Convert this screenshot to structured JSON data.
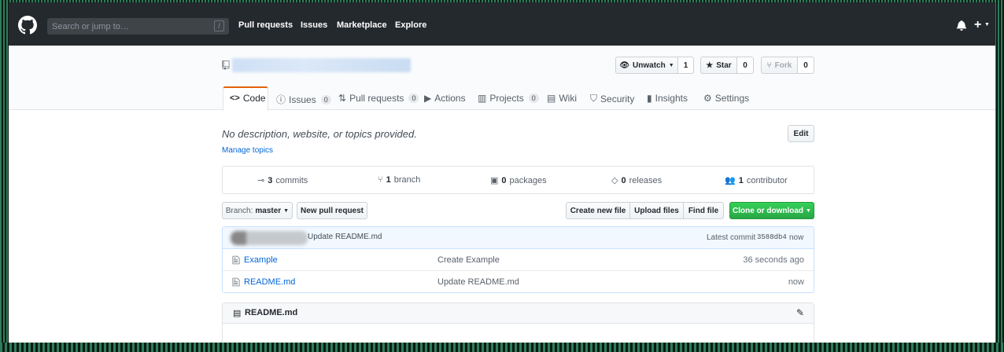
{
  "header": {
    "search_placeholder": "Search or jump to…",
    "search_shortcut": "/",
    "nav": [
      "Pull requests",
      "Issues",
      "Marketplace",
      "Explore"
    ]
  },
  "repo": {
    "watch_label": "Unwatch",
    "watch_count": "1",
    "star_label": "Star",
    "star_count": "0",
    "fork_label": "Fork",
    "fork_count": "0"
  },
  "tabs": [
    {
      "label": "Code",
      "badge": ""
    },
    {
      "label": "Issues",
      "badge": "0"
    },
    {
      "label": "Pull requests",
      "badge": "0"
    },
    {
      "label": "Actions",
      "badge": ""
    },
    {
      "label": "Projects",
      "badge": "0"
    },
    {
      "label": "Wiki",
      "badge": ""
    },
    {
      "label": "Security",
      "badge": ""
    },
    {
      "label": "Insights",
      "badge": ""
    },
    {
      "label": "Settings",
      "badge": ""
    }
  ],
  "about": {
    "description": "No description, website, or topics provided.",
    "edit_label": "Edit",
    "manage_topics": "Manage topics"
  },
  "stats": {
    "commits_count": "3",
    "commits_label": "commits",
    "branch_count": "1",
    "branch_label": "branch",
    "packages_count": "0",
    "packages_label": "packages",
    "releases_count": "0",
    "releases_label": "releases",
    "contributor_count": "1",
    "contributor_label": "contributor"
  },
  "toolbar": {
    "branch_prefix": "Branch:",
    "branch_name": "master",
    "new_pr": "New pull request",
    "create_file": "Create new file",
    "upload_files": "Upload files",
    "find_file": "Find file",
    "clone": "Clone or download"
  },
  "latest_commit": {
    "message": "Update README.md",
    "prefix": "Latest commit",
    "sha": "3588db4",
    "time": "now"
  },
  "files": [
    {
      "name": "Example",
      "message": "Create Example",
      "time": "36 seconds ago"
    },
    {
      "name": "README.md",
      "message": "Update README.md",
      "time": "now"
    }
  ],
  "readme": {
    "title": "README.md"
  }
}
